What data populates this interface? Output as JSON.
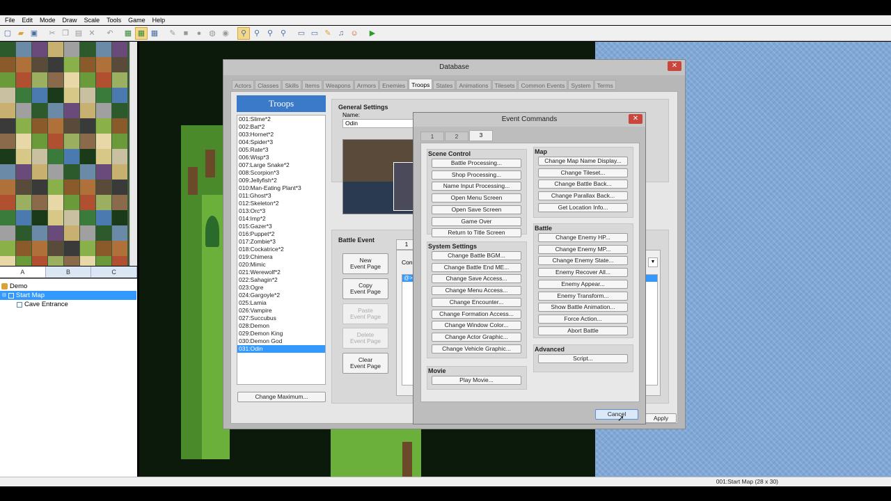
{
  "menubar": {
    "items": [
      "File",
      "Edit",
      "Mode",
      "Draw",
      "Scale",
      "Tools",
      "Game",
      "Help"
    ]
  },
  "toolbar": {
    "icons": [
      "new-icon",
      "open-icon",
      "save-icon",
      "cut-icon",
      "copy-icon",
      "paste-icon",
      "delete-icon",
      "undo-icon",
      "layer1-icon",
      "layer2-icon",
      "event-layer-icon",
      "pencil-icon",
      "rectangle-icon",
      "ellipse-icon",
      "flood-fill-icon",
      "shadow-pen-icon",
      "zoom-1-icon",
      "zoom-2-icon",
      "zoom-3-icon",
      "zoom-4-icon",
      "database-icon",
      "resource-manager-icon",
      "script-editor-icon",
      "sound-test-icon",
      "character-generator-icon",
      "playtest-icon"
    ]
  },
  "tileset_tabs": [
    "A",
    "B",
    "C"
  ],
  "map_tree": {
    "root": "Demo",
    "items": [
      "Start Map",
      "Cave Entrance"
    ]
  },
  "statusbar": {
    "text": "001:Start Map (28 x 30)"
  },
  "database": {
    "title": "Database",
    "tabs": [
      "Actors",
      "Classes",
      "Skills",
      "Items",
      "Weapons",
      "Armors",
      "Enemies",
      "Troops",
      "States",
      "Animations",
      "Tilesets",
      "Common Events",
      "System",
      "Terms"
    ],
    "selected_tab": "Troops",
    "troops_header": "Troops",
    "troops": [
      "001:Slime*2",
      "002:Bat*2",
      "003:Hornet*2",
      "004:Spider*3",
      "005:Rate*3",
      "006:Wisp*3",
      "007:Large Snake*2",
      "008:Scorpion*3",
      "009:Jellyfish*2",
      "010:Man-Eating Plant*3",
      "011:Ghost*3",
      "012:Skeleton*2",
      "013:Orc*3",
      "014:Imp*2",
      "015:Gazer*3",
      "016:Puppet*2",
      "017:Zombie*3",
      "018:Cockatrice*2",
      "019:Chimera",
      "020:Mimic",
      "021:Werewolf*2",
      "022:Sahagin*2",
      "023:Ogre",
      "024:Gargoyle*2",
      "025:Lamia",
      "026:Vampire",
      "027:Succubus",
      "028:Demon",
      "029:Demon King",
      "030:Demon God",
      "031:Odin"
    ],
    "selected_troop": "031:Odin",
    "change_maximum": "Change Maximum...",
    "general_settings": "General Settings",
    "name_label": "Name:",
    "name_value": "Odin",
    "battle_event": "Battle Event",
    "page_tab": "1",
    "condition_label": "Con",
    "list_marker": "@>",
    "buttons": {
      "new": [
        "New",
        "Event Page"
      ],
      "copy": [
        "Copy",
        "Event Page"
      ],
      "paste": [
        "Paste",
        "Event Page"
      ],
      "delete": [
        "Delete",
        "Event Page"
      ],
      "clear": [
        "Clear",
        "Event Page"
      ]
    },
    "apply": "Apply"
  },
  "event_commands": {
    "title": "Event Commands",
    "tabs": [
      "1",
      "2",
      "3"
    ],
    "selected_tab": "3",
    "scene_control": {
      "label": "Scene Control",
      "items": [
        "Battle Processing...",
        "Shop Processing...",
        "Name Input Processing...",
        "Open Menu Screen",
        "Open Save Screen",
        "Game Over",
        "Return to Title Screen"
      ]
    },
    "system_settings": {
      "label": "System Settings",
      "items": [
        "Change Battle BGM...",
        "Change Battle End ME...",
        "Change Save Access...",
        "Change Menu Access...",
        "Change Encounter...",
        "Change Formation Access...",
        "Change Window Color...",
        "Change Actor Graphic...",
        "Change Vehicle Graphic..."
      ]
    },
    "movie": {
      "label": "Movie",
      "items": [
        "Play Movie..."
      ]
    },
    "map": {
      "label": "Map",
      "items": [
        "Change Map Name Display...",
        "Change Tileset...",
        "Change Battle Back...",
        "Change Parallax Back...",
        "Get Location Info..."
      ]
    },
    "battle": {
      "label": "Battle",
      "items": [
        "Change Enemy HP...",
        "Change Enemy MP...",
        "Change Enemy State...",
        "Enemy Recover All...",
        "Enemy Appear...",
        "Enemy Transform...",
        "Show Battle Animation...",
        "Force Action...",
        "Abort Battle"
      ]
    },
    "advanced": {
      "label": "Advanced",
      "items": [
        "Script..."
      ]
    },
    "cancel": "Cancel"
  },
  "colors": {
    "accent": "#3399ff",
    "troops_header": "#3b79c9",
    "close": "#c9463d"
  }
}
